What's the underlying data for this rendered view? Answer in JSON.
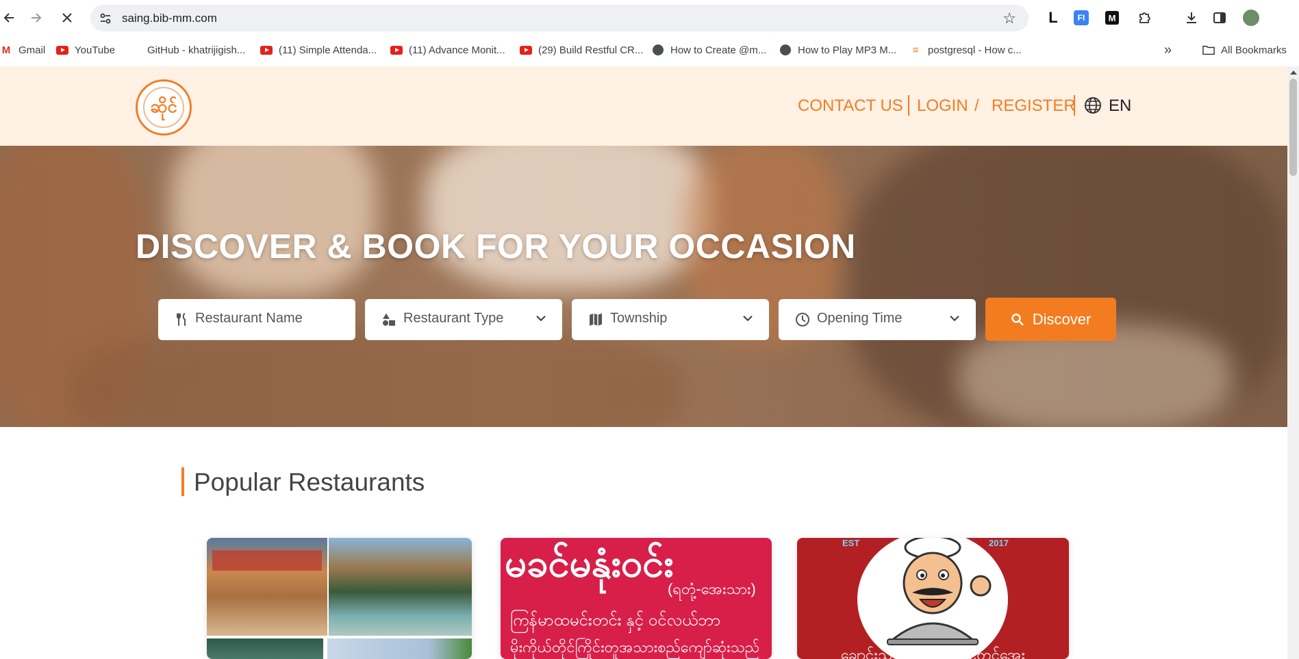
{
  "browser": {
    "url": "saing.bib-mm.com",
    "bookmarks": [
      "Gmail",
      "YouTube",
      "GitHub - khatrijigish...",
      "(11) Simple Attenda...",
      "(11) Advance Monit...",
      "(29) Build Restful CR...",
      "How to Create @m...",
      "How to Play MP3 M...",
      "postgresql - How c..."
    ],
    "all_bookmarks": "All Bookmarks",
    "extensions": [
      "L",
      "FI",
      "M"
    ],
    "overflow": "»"
  },
  "header": {
    "logo_text": "ဆိုင်",
    "contact": "CONTACT US",
    "login": "LOGIN",
    "slash": "/",
    "register": "REGISTER",
    "lang": "EN"
  },
  "hero": {
    "title": "DISCOVER & BOOK FOR YOUR OCCASION",
    "restaurant_name_placeholder": "Restaurant Name",
    "restaurant_type": "Restaurant Type",
    "township": "Township",
    "opening_time": "Opening Time",
    "discover": "Discover"
  },
  "popular": {
    "title": "Popular Restaurants",
    "card2_big": "မခင်မနုံးဝင်း",
    "card2_sub": "(ရတုံ့-အေးသား)",
    "card2_line1": "ကြန်မာထမင်းတင်း နှင့် ဝင်လယ်ဘာ",
    "card2_line2": "မိုးကိုယ်တိုင်ကြိုင်းတူအသားစည်ကျော်ဆုံးသည်",
    "card3_est_left": "EST",
    "card3_est_right": "2017",
    "card3_caption": "ချောင်းသာကမ်းခြေမတင်တင်အေး"
  },
  "colors": {
    "accent": "#f47c20",
    "header_bg": "#fff1e4",
    "card2_bg": "#d81f4a",
    "card3_bg": "#b32024"
  }
}
